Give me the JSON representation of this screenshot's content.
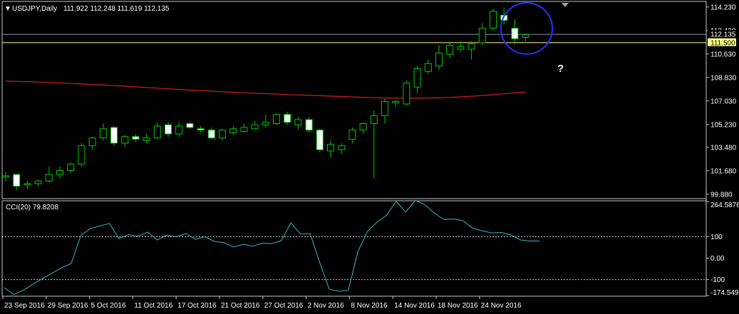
{
  "header": {
    "symbol_label": "USDJPY,Daily",
    "ohlc": "111.922 112.248 111.619 112.135"
  },
  "indicator": {
    "label": "CCI(20) 79.8208"
  },
  "annotation": {
    "question": "?"
  },
  "colors": {
    "background": "#000000",
    "bull": "#00c800",
    "bear_body": "#ffffff",
    "ma": "#d21e1e",
    "cci": "#3cb4c8",
    "ask": "#7f8fa0",
    "bid": "#ffff80",
    "circle": "#2233ff",
    "frame": "#c8c8c8",
    "text": "#ffffff"
  },
  "chart_data": [
    {
      "type": "candlestick",
      "symbol": "USDJPY",
      "timeframe": "Daily",
      "price_axis": {
        "ticks": [
          "114.230",
          "112.420",
          "110.630",
          "108.830",
          "107.030",
          "105.230",
          "103.480",
          "101.680",
          "99.880"
        ],
        "range": [
          99.6,
          114.6
        ]
      },
      "x_axis": {
        "labels": [
          "23 Sep 2016",
          "29 Sep 2016",
          "5 Oct 2016",
          "11 Oct 2016",
          "17 Oct 2016",
          "21 Oct 2016",
          "27 Oct 2016",
          "2 Nov 2016",
          "8 Nov 2016",
          "14 Nov 2016",
          "18 Nov 2016",
          "24 Nov 2016"
        ],
        "label_index": [
          0,
          4,
          8,
          12,
          16,
          20,
          24,
          28,
          32,
          36,
          40,
          44
        ]
      },
      "price_labels": {
        "ask": "112.135",
        "bid": "111.500",
        "ask_value": 112.135,
        "bid_value": 111.5
      },
      "candles": [
        {
          "o": 101.2,
          "h": 101.6,
          "l": 100.9,
          "c": 101.3
        },
        {
          "o": 101.4,
          "h": 101.4,
          "l": 100.2,
          "c": 100.5
        },
        {
          "o": 100.6,
          "h": 100.9,
          "l": 100.3,
          "c": 100.7
        },
        {
          "o": 100.7,
          "h": 101.0,
          "l": 100.5,
          "c": 100.9
        },
        {
          "o": 100.9,
          "h": 102.0,
          "l": 100.8,
          "c": 101.4
        },
        {
          "o": 101.4,
          "h": 102.0,
          "l": 101.1,
          "c": 101.7
        },
        {
          "o": 101.7,
          "h": 102.3,
          "l": 101.5,
          "c": 102.2
        },
        {
          "o": 102.2,
          "h": 103.8,
          "l": 102.0,
          "c": 103.6
        },
        {
          "o": 103.6,
          "h": 104.3,
          "l": 103.3,
          "c": 104.2
        },
        {
          "o": 104.2,
          "h": 105.3,
          "l": 104.0,
          "c": 104.9
        },
        {
          "o": 105.0,
          "h": 105.1,
          "l": 103.6,
          "c": 103.8
        },
        {
          "o": 103.8,
          "h": 104.4,
          "l": 103.5,
          "c": 104.3
        },
        {
          "o": 104.3,
          "h": 104.5,
          "l": 103.9,
          "c": 104.1
        },
        {
          "o": 104.0,
          "h": 104.5,
          "l": 103.8,
          "c": 104.2
        },
        {
          "o": 104.2,
          "h": 105.4,
          "l": 104.1,
          "c": 105.1
        },
        {
          "o": 105.2,
          "h": 105.4,
          "l": 104.3,
          "c": 104.5
        },
        {
          "o": 104.5,
          "h": 105.4,
          "l": 104.3,
          "c": 105.1
        },
        {
          "o": 105.3,
          "h": 105.4,
          "l": 104.9,
          "c": 105.0
        },
        {
          "o": 104.9,
          "h": 105.1,
          "l": 104.6,
          "c": 104.8
        },
        {
          "o": 104.8,
          "h": 105.0,
          "l": 104.1,
          "c": 104.2
        },
        {
          "o": 104.2,
          "h": 104.9,
          "l": 104.0,
          "c": 104.8
        },
        {
          "o": 104.6,
          "h": 105.1,
          "l": 104.4,
          "c": 104.9
        },
        {
          "o": 104.7,
          "h": 105.3,
          "l": 104.6,
          "c": 105.0
        },
        {
          "o": 104.9,
          "h": 105.5,
          "l": 104.8,
          "c": 105.2
        },
        {
          "o": 105.2,
          "h": 106.0,
          "l": 105.0,
          "c": 105.4
        },
        {
          "o": 105.3,
          "h": 106.1,
          "l": 105.2,
          "c": 106.0
        },
        {
          "o": 106.0,
          "h": 106.2,
          "l": 105.2,
          "c": 105.4
        },
        {
          "o": 105.2,
          "h": 105.8,
          "l": 104.8,
          "c": 105.6
        },
        {
          "o": 105.6,
          "h": 105.8,
          "l": 104.6,
          "c": 104.8
        },
        {
          "o": 104.8,
          "h": 104.9,
          "l": 103.1,
          "c": 103.3
        },
        {
          "o": 103.2,
          "h": 104.0,
          "l": 102.7,
          "c": 103.7
        },
        {
          "o": 103.3,
          "h": 103.8,
          "l": 103.0,
          "c": 103.6
        },
        {
          "o": 104.1,
          "h": 105.0,
          "l": 103.8,
          "c": 104.8
        },
        {
          "o": 104.8,
          "h": 105.4,
          "l": 104.5,
          "c": 105.3
        },
        {
          "o": 105.3,
          "h": 106.3,
          "l": 101.1,
          "c": 105.9
        },
        {
          "o": 105.9,
          "h": 107.2,
          "l": 105.3,
          "c": 107.0
        },
        {
          "o": 106.9,
          "h": 107.1,
          "l": 106.6,
          "c": 107.0
        },
        {
          "o": 106.8,
          "h": 108.6,
          "l": 106.7,
          "c": 108.4
        },
        {
          "o": 108.1,
          "h": 109.7,
          "l": 107.6,
          "c": 109.5
        },
        {
          "o": 109.3,
          "h": 110.2,
          "l": 109.1,
          "c": 109.9
        },
        {
          "o": 109.7,
          "h": 111.3,
          "l": 109.4,
          "c": 110.7
        },
        {
          "o": 110.6,
          "h": 111.6,
          "l": 110.3,
          "c": 111.3
        },
        {
          "o": 111.0,
          "h": 111.6,
          "l": 110.8,
          "c": 111.2
        },
        {
          "o": 111.0,
          "h": 111.6,
          "l": 110.2,
          "c": 111.4
        },
        {
          "o": 111.5,
          "h": 113.0,
          "l": 111.3,
          "c": 112.6
        },
        {
          "o": 112.6,
          "h": 114.1,
          "l": 112.4,
          "c": 113.9
        },
        {
          "o": 113.6,
          "h": 114.2,
          "l": 112.9,
          "c": 113.2
        },
        {
          "o": 112.6,
          "h": 113.3,
          "l": 111.4,
          "c": 111.8
        },
        {
          "o": 111.9,
          "h": 112.2,
          "l": 111.6,
          "c": 112.1
        }
      ],
      "moving_average": [
        108.55,
        108.53,
        108.51,
        108.48,
        108.45,
        108.41,
        108.37,
        108.33,
        108.29,
        108.25,
        108.2,
        108.16,
        108.11,
        108.06,
        108.01,
        107.96,
        107.91,
        107.86,
        107.82,
        107.78,
        107.74,
        107.7,
        107.66,
        107.62,
        107.59,
        107.55,
        107.52,
        107.49,
        107.46,
        107.43,
        107.4,
        107.37,
        107.34,
        107.31,
        107.28,
        107.26,
        107.25,
        107.24,
        107.24,
        107.25,
        107.27,
        107.3,
        107.34,
        107.39,
        107.45,
        107.51,
        107.58,
        107.65,
        107.72
      ]
    },
    {
      "type": "line",
      "name": "CCI(20)",
      "y_axis": {
        "ticks": [
          "264.5876",
          "100",
          "0.00",
          "-100",
          "-174.5491"
        ],
        "range": [
          -174.5491,
          264.5876
        ]
      },
      "reference_lines": [
        100,
        -100
      ],
      "values": [
        -138,
        -170,
        -150,
        -122,
        -95,
        -70,
        -45,
        -25,
        105,
        138,
        150,
        162,
        92,
        110,
        103,
        122,
        85,
        108,
        100,
        115,
        88,
        100,
        78,
        72,
        52,
        65,
        56,
        70,
        68,
        82,
        165,
        112,
        115,
        -20,
        -145,
        -155,
        -150,
        30,
        125,
        168,
        200,
        265,
        215,
        270,
        250,
        210,
        180,
        183,
        175,
        140,
        128,
        118,
        120,
        108,
        85,
        80,
        79.8208
      ]
    }
  ]
}
